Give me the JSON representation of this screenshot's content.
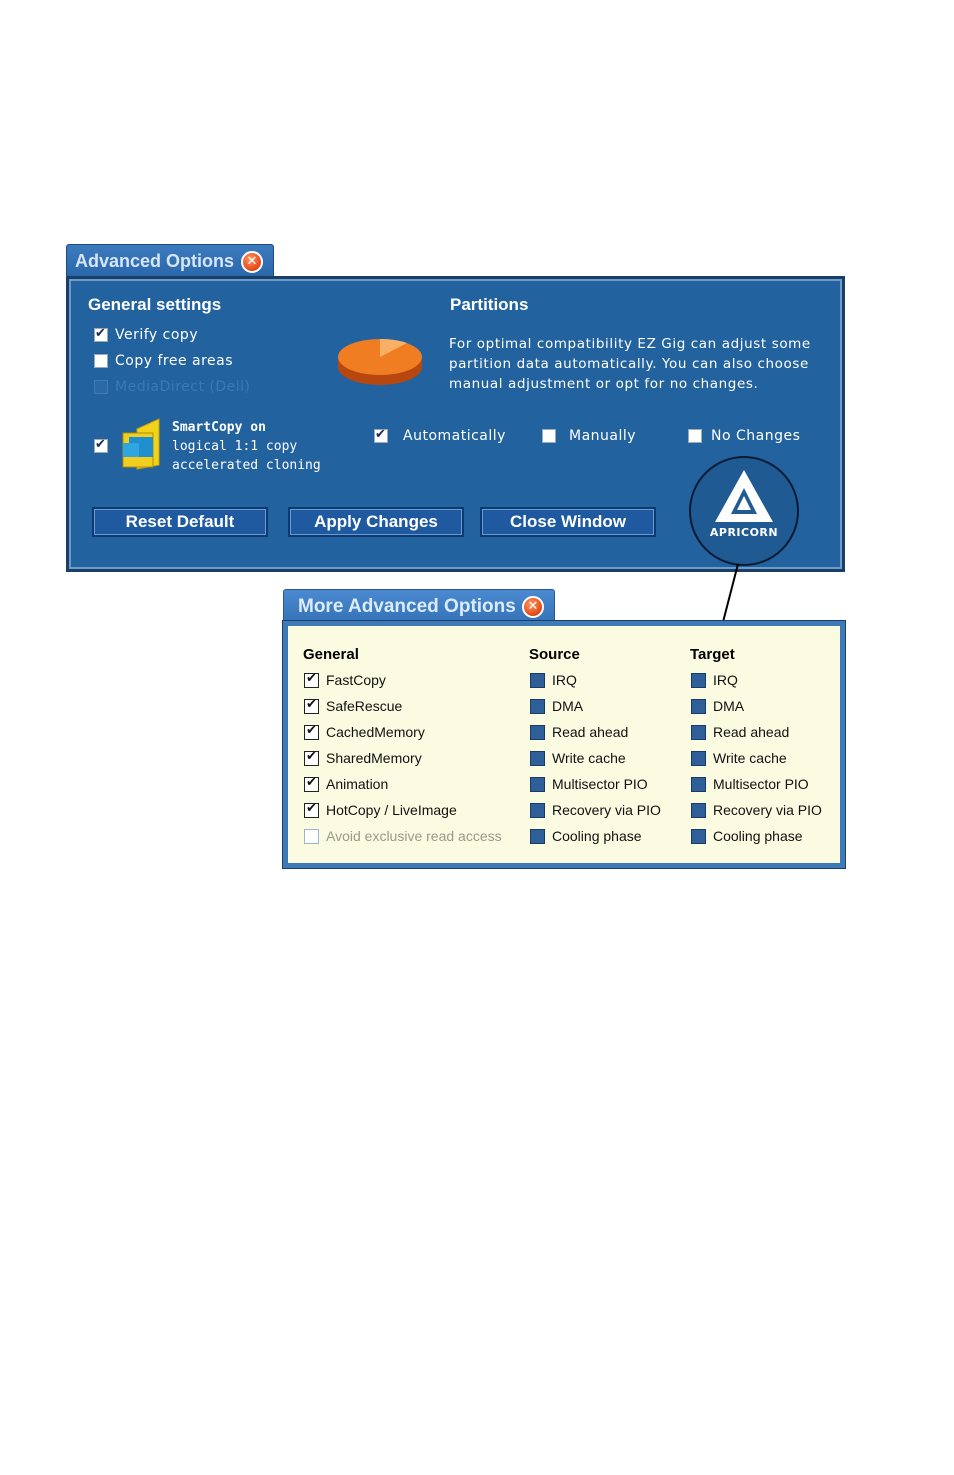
{
  "advanced": {
    "title": "Advanced Options",
    "general": {
      "heading": "General settings",
      "verify_copy": "Verify copy",
      "copy_free_areas": "Copy free areas",
      "media_direct": "MediaDirect (Dell)"
    },
    "smartcopy": {
      "title": "SmartCopy on",
      "line2": "logical 1:1 copy",
      "line3": "accelerated cloning"
    },
    "partitions": {
      "heading": "Partitions",
      "desc1": "For optimal compatibility EZ Gig can adjust some",
      "desc2": "partition data automatically. You can also choose",
      "desc3": "manual adjustment or opt for no changes.",
      "automatically": "Automatically",
      "manually": "Manually",
      "no_changes": "No Changes"
    },
    "buttons": {
      "reset": "Reset Default",
      "apply": "Apply Changes",
      "close": "Close Window"
    },
    "logo_text": "APRICORN"
  },
  "more": {
    "title": "More Advanced Options",
    "general": {
      "heading": "General",
      "items": [
        "FastCopy",
        "SafeRescue",
        "CachedMemory",
        "SharedMemory",
        "Animation",
        "HotCopy / LiveImage",
        "Avoid exclusive read access"
      ]
    },
    "source": {
      "heading": "Source",
      "items": [
        "IRQ",
        "DMA",
        "Read ahead",
        "Write cache",
        "Multisector PIO",
        "Recovery via PIO",
        "Cooling phase"
      ]
    },
    "target": {
      "heading": "Target",
      "items": [
        "IRQ",
        "DMA",
        "Read ahead",
        "Write cache",
        "Multisector PIO",
        "Recovery via PIO",
        "Cooling phase"
      ]
    }
  }
}
